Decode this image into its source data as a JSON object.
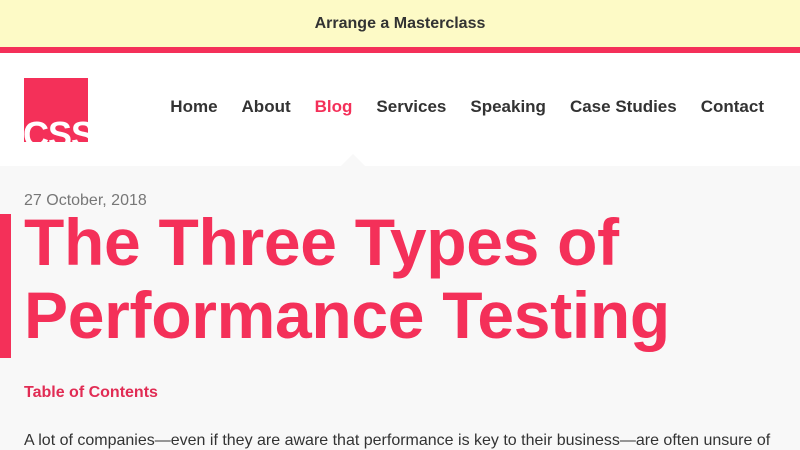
{
  "banner": {
    "link_label": "Arrange a Masterclass"
  },
  "header": {
    "logo_text": "CSS",
    "nav": [
      {
        "label": "Home"
      },
      {
        "label": "About"
      },
      {
        "label": "Blog",
        "active": true
      },
      {
        "label": "Services"
      },
      {
        "label": "Speaking"
      },
      {
        "label": "Case Studies"
      },
      {
        "label": "Contact"
      }
    ]
  },
  "post": {
    "date": "27 October, 2018",
    "title": "The Three Types of Performance Testing",
    "toc_label": "Table of Contents",
    "intro": "A lot of companies—even if they are aware that performance is key to their business—are often unsure of"
  },
  "colors": {
    "accent": "#f43059",
    "banner_bg": "#fdfac6",
    "text": "#333333",
    "muted": "#777777",
    "page_bg": "#f8f8f8"
  }
}
